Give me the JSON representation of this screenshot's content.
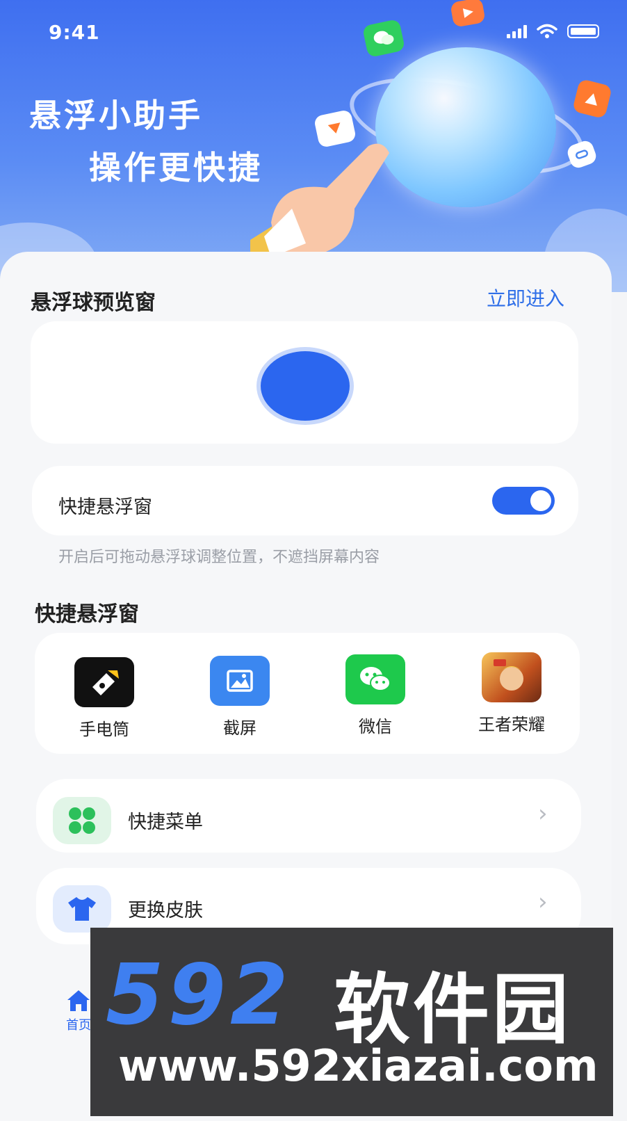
{
  "status_bar": {
    "time": "9:41"
  },
  "hero": {
    "title_line1": "悬浮小助手",
    "title_line2": "操作更快捷"
  },
  "preview": {
    "title": "悬浮球预览窗",
    "enter_link": "立即进入"
  },
  "toggle_row": {
    "label": "快捷悬浮窗",
    "enabled": true,
    "hint": "开启后可拖动悬浮球调整位置，不遮挡屏幕内容"
  },
  "shortcuts": {
    "title": "快捷悬浮窗",
    "apps": [
      {
        "label": "手电筒",
        "icon": "flashlight-icon"
      },
      {
        "label": "截屏",
        "icon": "screenshot-icon"
      },
      {
        "label": "微信",
        "icon": "wechat-icon"
      },
      {
        "label": "王者荣耀",
        "icon": "game-icon"
      }
    ]
  },
  "menu": [
    {
      "label": "快捷菜单",
      "icon": "grid-icon"
    },
    {
      "label": "更换皮肤",
      "icon": "shirt-icon"
    }
  ],
  "tabbar": {
    "home_label": "首页"
  },
  "watermark": {
    "brand_num": "592",
    "brand_cn": "软件园",
    "url": "www.592xiazai.com"
  },
  "colors": {
    "accent": "#2b66ef",
    "hero_top": "#3f6ff0",
    "wechat": "#1ec94c"
  }
}
